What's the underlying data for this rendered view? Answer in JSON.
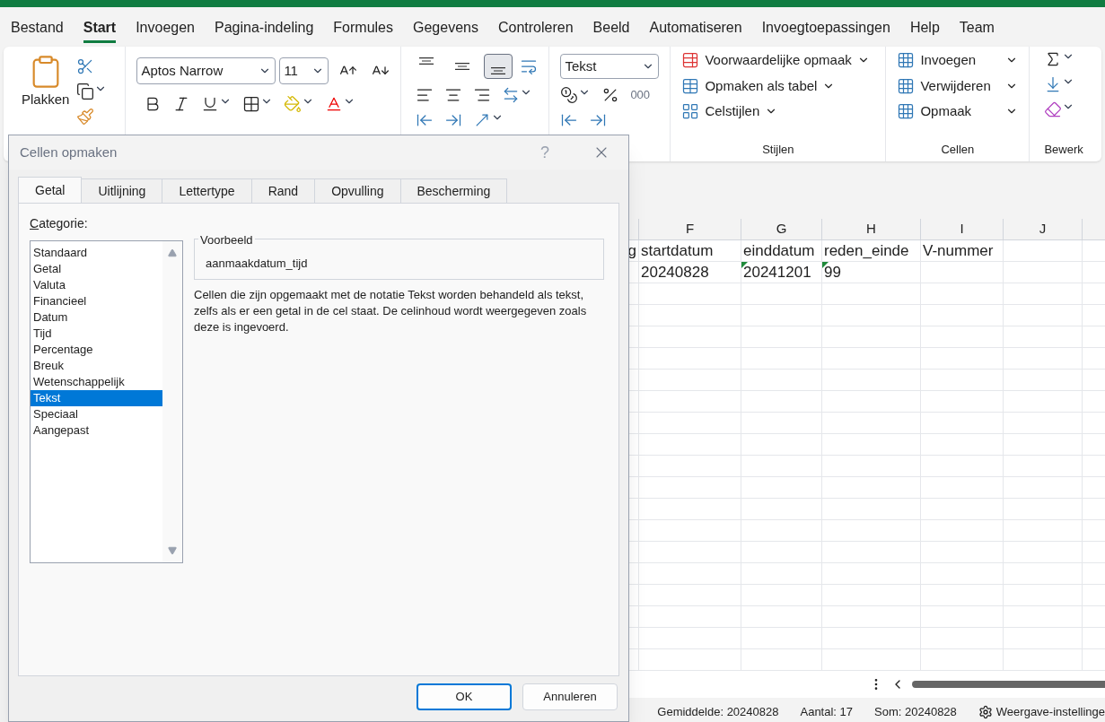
{
  "menu_tabs": [
    {
      "label": "Bestand",
      "selected": false
    },
    {
      "label": "Start",
      "selected": true
    },
    {
      "label": "Invoegen",
      "selected": false
    },
    {
      "label": "Pagina-indeling",
      "selected": false
    },
    {
      "label": "Formules",
      "selected": false
    },
    {
      "label": "Gegevens",
      "selected": false
    },
    {
      "label": "Controleren",
      "selected": false
    },
    {
      "label": "Beeld",
      "selected": false
    },
    {
      "label": "Automatiseren",
      "selected": false
    },
    {
      "label": "Invoegtoepassingen",
      "selected": false
    },
    {
      "label": "Help",
      "selected": false
    },
    {
      "label": "Team",
      "selected": false
    }
  ],
  "ribbon": {
    "paste_label": "Plakken",
    "font_name": "Aptos Narrow",
    "font_size": "11",
    "alignment": [
      {
        "kind": "top",
        "selected": false
      },
      {
        "kind": "middle",
        "selected": false
      },
      {
        "kind": "bottom",
        "selected": true
      }
    ],
    "number_format": "Tekst",
    "thousands": "000",
    "styles": [
      "Voorwaardelijke opmaak",
      "Opmaken als tabel",
      "Celstijlen"
    ],
    "styles_group": "Stijlen",
    "cells": [
      "Invoegen",
      "Verwijderen",
      "Opmaak"
    ],
    "cells_group": "Cellen",
    "editing_group": "Bewerk"
  },
  "sheet": {
    "columns": [
      "F",
      "G",
      "H",
      "I",
      "J"
    ],
    "rows": [
      {
        "partial": "g",
        "cells": [
          {
            "text": "startdatum",
            "text_marker": false
          },
          {
            "text": "einddatum",
            "text_marker": false
          },
          {
            "text": "reden_einde",
            "text_marker": false
          },
          {
            "text": "V-nummer",
            "text_marker": false
          }
        ]
      },
      {
        "cells": [
          {
            "text": "20240828",
            "text_marker": false
          },
          {
            "text": "20241201",
            "text_marker": true
          },
          {
            "text": "99",
            "text_marker": true
          }
        ]
      }
    ]
  },
  "dialog": {
    "title": "Cellen opmaken",
    "help": "?",
    "tabs": [
      {
        "label": "Getal",
        "selected": true
      },
      {
        "label": "Uitlijning",
        "selected": false
      },
      {
        "label": "Lettertype",
        "selected": false
      },
      {
        "label": "Rand",
        "selected": false
      },
      {
        "label": "Opvulling",
        "selected": false
      },
      {
        "label": "Bescherming",
        "selected": false
      }
    ],
    "category_label": "Categorie:",
    "categories": [
      {
        "label": "Standaard",
        "selected": false
      },
      {
        "label": "Getal",
        "selected": false
      },
      {
        "label": "Valuta",
        "selected": false
      },
      {
        "label": "Financieel",
        "selected": false
      },
      {
        "label": "Datum",
        "selected": false
      },
      {
        "label": "Tijd",
        "selected": false
      },
      {
        "label": "Percentage",
        "selected": false
      },
      {
        "label": "Breuk",
        "selected": false
      },
      {
        "label": "Wetenschappelijk",
        "selected": false
      },
      {
        "label": "Tekst",
        "selected": true
      },
      {
        "label": "Speciaal",
        "selected": false
      },
      {
        "label": "Aangepast",
        "selected": false
      }
    ],
    "sample_label": "Voorbeeld",
    "sample_value": "aanmaakdatum_tijd",
    "description": "Cellen die zijn opgemaakt met de notatie Tekst worden behandeld als tekst, zelfs als er een getal in de cel staat. De celinhoud wordt weergegeven zoals deze is ingevoerd.",
    "buttons": [
      {
        "label": "OK",
        "kind": "primary"
      },
      {
        "label": "Annuleren",
        "kind": "secondary"
      }
    ]
  },
  "status_bar": {
    "average": "Gemiddelde: 20240828",
    "count": "Aantal: 17",
    "sum": "Som: 20240828",
    "view_settings": "Weergave-instellinge"
  }
}
